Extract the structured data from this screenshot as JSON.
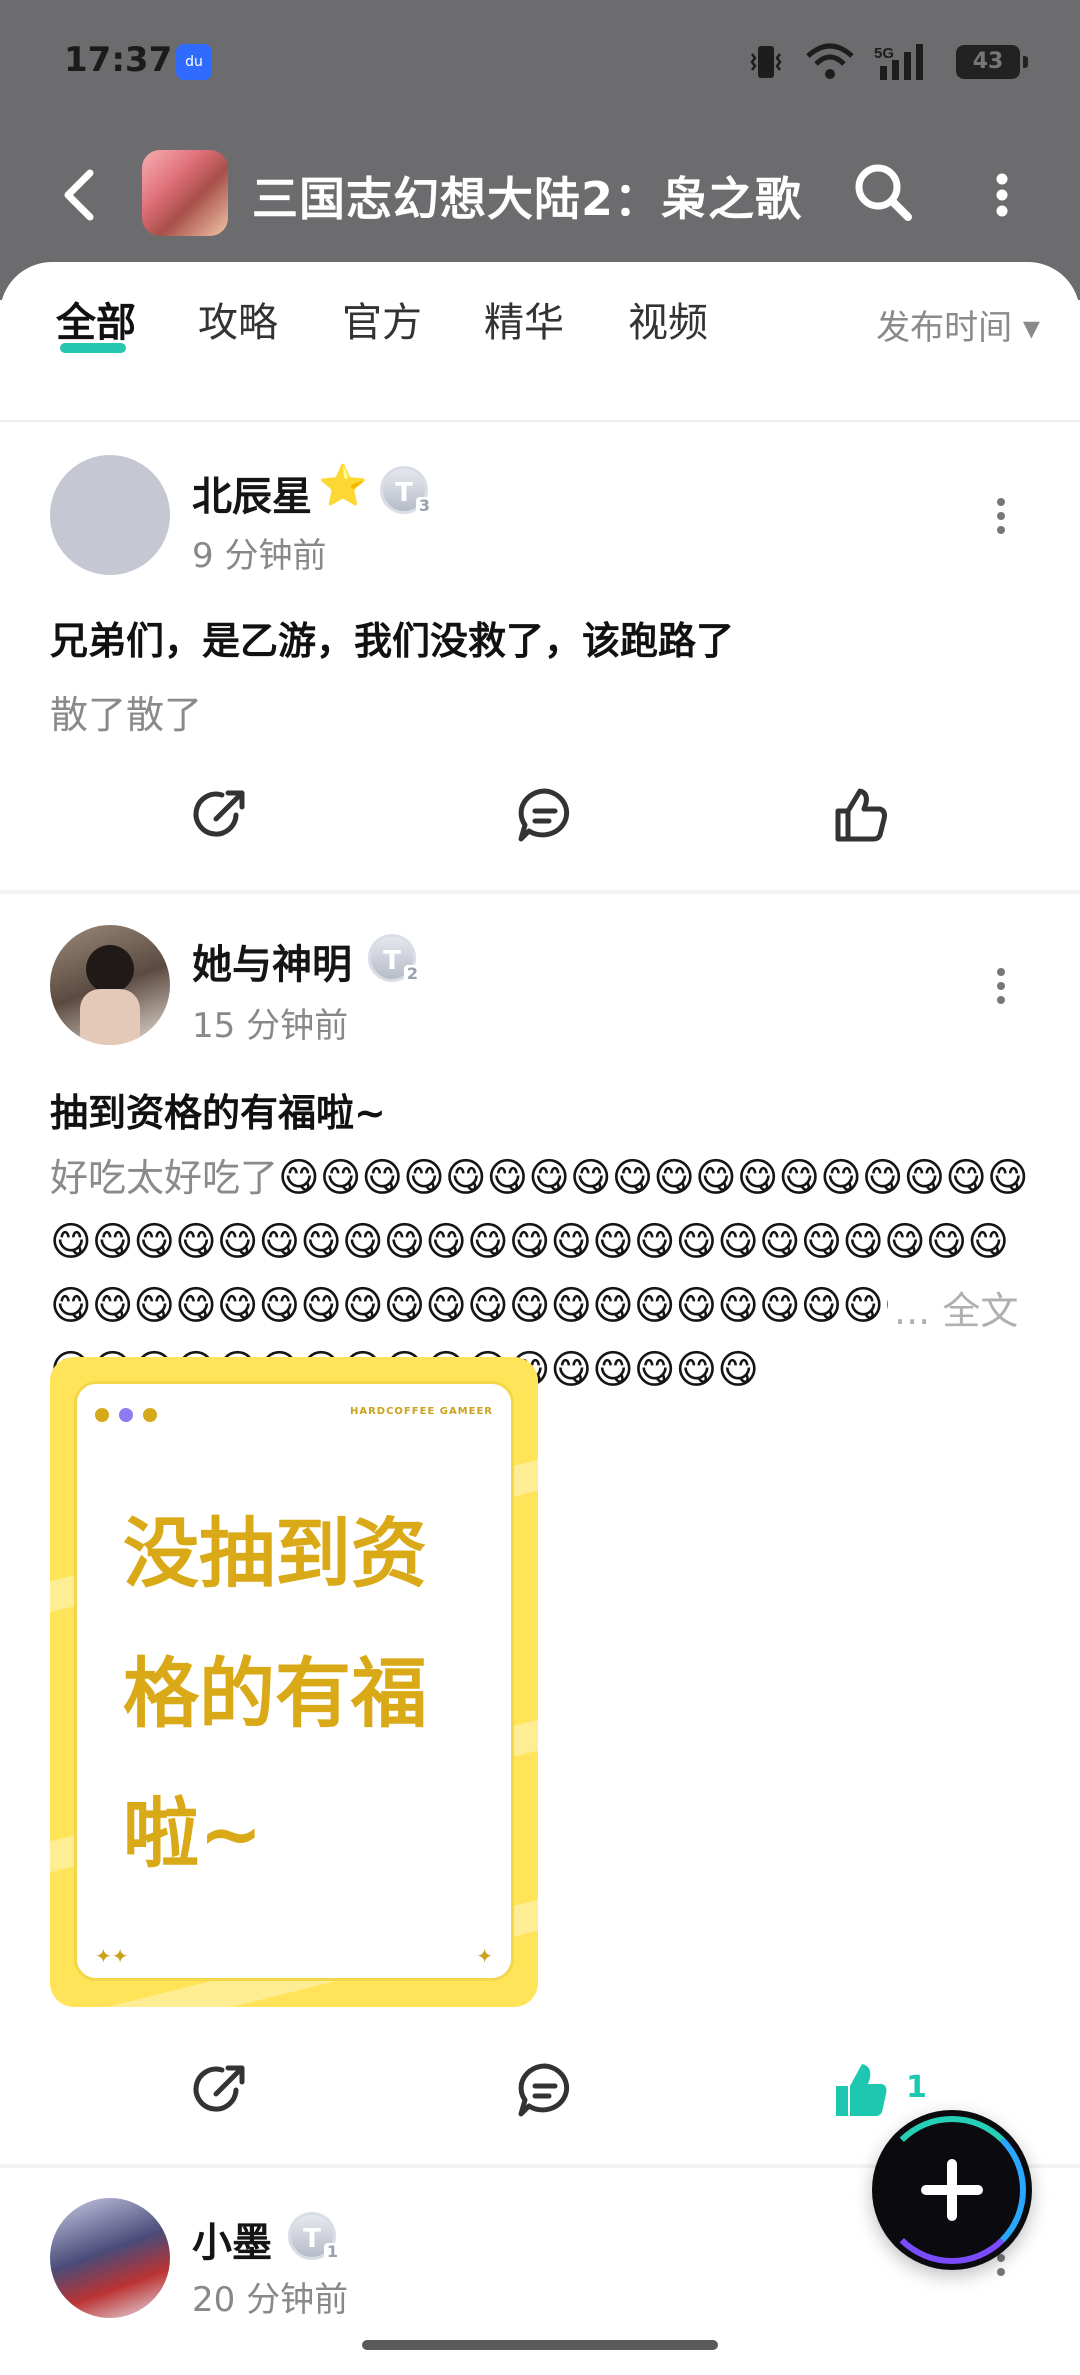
{
  "status_bar": {
    "time": "17:37",
    "app_icon": "du",
    "battery": "43",
    "network": "5G"
  },
  "header": {
    "title": "三国志幻想大陆2：枭之歌"
  },
  "tabs": [
    {
      "label": "全部"
    },
    {
      "label": "攻略"
    },
    {
      "label": "官方"
    },
    {
      "label": "精华"
    },
    {
      "label": "视频"
    }
  ],
  "sort": {
    "label": "发布时间 ▾"
  },
  "posts": [
    {
      "username": "北辰星",
      "star": "⭐",
      "badge": {
        "letter": "T",
        "level": "3"
      },
      "time": "9 分钟前",
      "title": "兄弟们，是乙游，我们没救了，该跑路了",
      "body": "散了散了"
    },
    {
      "username": "她与神明",
      "badge": {
        "letter": "T",
        "level": "2"
      },
      "time": "15 分钟前",
      "title": "抽到资格的有福啦~",
      "body_prefix": "好吃太好吃了",
      "emojis": "😋😋😋😋😋😋😋😋😋😋😋😋😋😋😋😋😋😋😋😋😋😋😋😋😋😋😋😋😋😋😋😋😋😋😋😋😋😋😋😋😋😋😋😋😋😋😋😋😋😋😋😋😋😋😋😋😋😋😋😋😋😋😋😋😋😋😋😋😋😋😋😋😋😋😋😋😋😋😋😋😋",
      "more": "... 全文",
      "image": {
        "brand": "HARDCOFFEE GAMEER",
        "text": "没抽到资格的有福啦~"
      },
      "like_count": "1"
    },
    {
      "username": "小墨",
      "badge": {
        "letter": "T",
        "level": "1"
      },
      "time": "20 分钟前"
    }
  ],
  "colors": {
    "accent": "#26c6b0",
    "header_bg": "#6c6c6f",
    "image_yellow": "#ffe45a"
  }
}
